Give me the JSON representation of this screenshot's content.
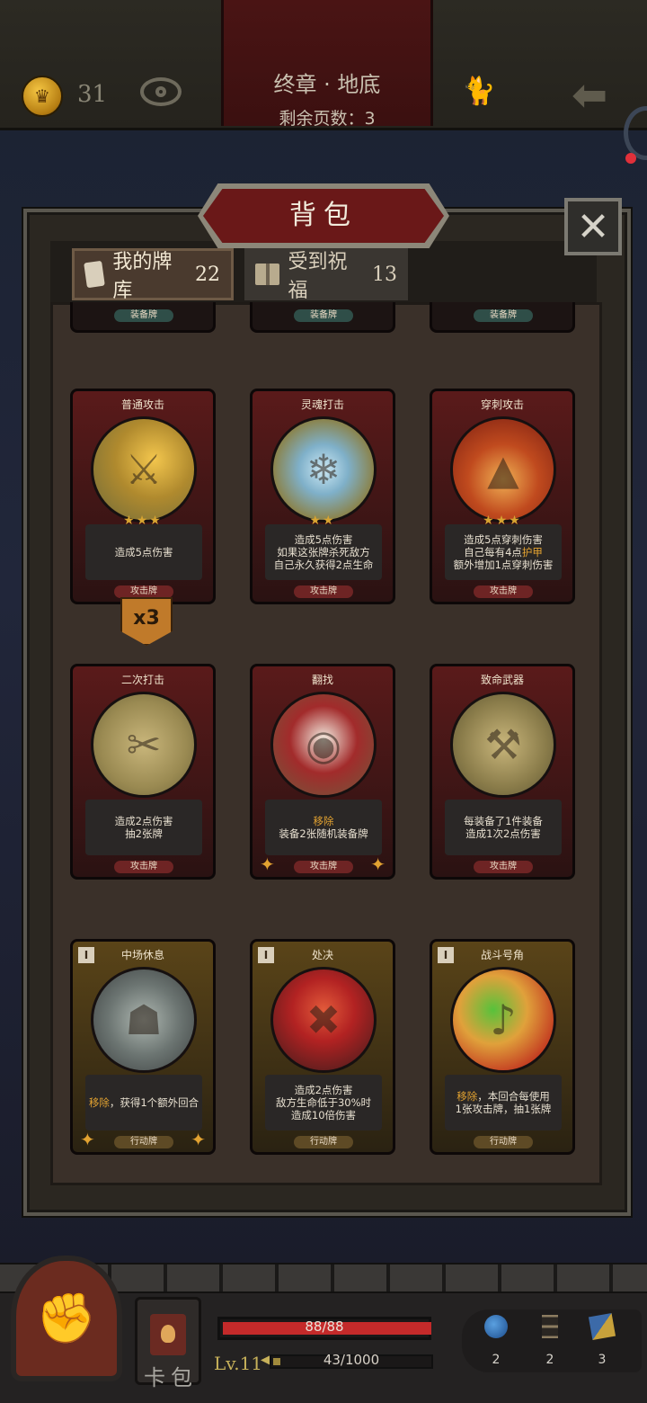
{
  "topbar": {
    "coins": "31",
    "chapter_title": "终章 · 地底",
    "pages_left": "剩余页数：3",
    "icons": [
      "coin-icon",
      "eye-icon",
      "cats-icon",
      "back-arrow-icon"
    ]
  },
  "panel": {
    "title": "背包",
    "close_label": "✕",
    "tabs": [
      {
        "label": "我的牌库",
        "count": "22",
        "icon": "cards-icon"
      },
      {
        "label": "受到祝福",
        "count": "13",
        "icon": "gift-icon"
      }
    ]
  },
  "partial_row": {
    "type_labels": [
      "装备牌",
      "装备牌",
      "装备牌"
    ]
  },
  "cards": [
    {
      "name": "普通攻击",
      "stars": "★★★",
      "desc": [
        "造成5点伤害"
      ],
      "type": "攻击牌",
      "kind": "attack",
      "icon": "sword-icon"
    },
    {
      "name": "灵魂打击",
      "stars": "★★",
      "desc": [
        "造成5点伤害",
        "如果这张牌杀死敌方",
        "自己永久获得2点生命"
      ],
      "type": "攻击牌",
      "kind": "attack",
      "icon": "ice-shard-icon"
    },
    {
      "name": "穿刺攻击",
      "stars": "★★★",
      "desc": [
        "造成5点穿刺伤害",
        "自己每有4点护甲",
        "额外增加1点穿刺伤害"
      ],
      "type": "攻击牌",
      "kind": "attack",
      "icon": "spikes-icon"
    },
    {
      "name": "二次打击",
      "stars": "",
      "desc": [
        "造成2点伤害",
        "抽2张牌"
      ],
      "type": "攻击牌",
      "kind": "attack",
      "icon": "daggers-icon"
    },
    {
      "name": "翻找",
      "stars": "",
      "desc": [
        "移除",
        "装备2张随机装备牌"
      ],
      "type": "攻击牌",
      "kind": "attack",
      "icon": "hood-girl-icon"
    },
    {
      "name": "致命武器",
      "stars": "",
      "desc": [
        "每装备了1件装备",
        "造成1次2点伤害"
      ],
      "type": "攻击牌",
      "kind": "attack",
      "icon": "weapons-icon"
    },
    {
      "name": "中场休息",
      "stars": "",
      "desc": [
        "移除，获得1个额外回合"
      ],
      "type": "行动牌",
      "kind": "action",
      "icon": "hooded-figure-icon",
      "cost": "I"
    },
    {
      "name": "处决",
      "stars": "",
      "desc": [
        "造成2点伤害",
        "敌方生命低于30%时",
        "造成10倍伤害"
      ],
      "type": "行动牌",
      "kind": "action",
      "icon": "execution-icon",
      "cost": "I"
    },
    {
      "name": "战斗号角",
      "stars": "",
      "desc": [
        "移除，本回合每使用",
        "1张攻击牌，抽1张牌"
      ],
      "type": "行动牌",
      "kind": "action",
      "icon": "horn-icon",
      "cost": "I"
    }
  ],
  "badge": "x3",
  "bottom": {
    "hp_text": "88/88",
    "hp_fraction": 1.0,
    "level": "Lv.11",
    "xp_text": "43/1000",
    "xp_fraction": 0.043,
    "deck_label": "卡包",
    "resources": [
      {
        "icon": "potion-icon",
        "value": "2"
      },
      {
        "icon": "hourglass-icon",
        "value": "2"
      },
      {
        "icon": "cards-icon",
        "value": "3"
      }
    ]
  },
  "colors": {
    "attack_frame": "#5a1a1a",
    "action_frame": "#5a4418",
    "highlight": "#e2a231",
    "hp": "#c42a2a"
  }
}
